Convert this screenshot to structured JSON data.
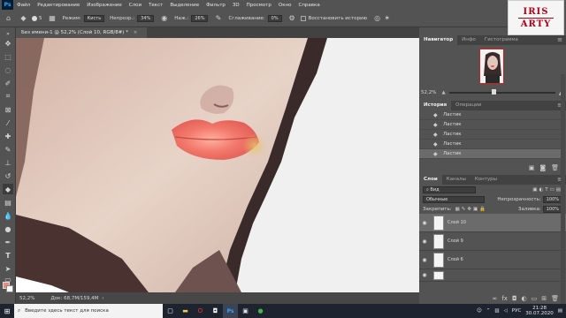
{
  "menubar": {
    "logo": "Ps",
    "items": [
      "Файл",
      "Редактирование",
      "Изображение",
      "Слои",
      "Текст",
      "Выделение",
      "Фильтр",
      "3D",
      "Просмотр",
      "Окно",
      "Справка"
    ]
  },
  "brand": {
    "line1": "IRIS",
    "line2": "ARTY"
  },
  "options": {
    "mode_label": "Режим:",
    "mode_value": "Кисть",
    "opacity_label": "Непрозр.:",
    "opacity_value": "34%",
    "pressure_label": "Наж.:",
    "pressure_value": "26%",
    "smoothing_label": "Сглаживание:",
    "smoothing_value": "0%",
    "restore_history_label": "Восстановить историю",
    "brush_size": "5"
  },
  "document": {
    "tab_label": "Без имени-1 @ 52,2% (Слой 10, RGB/8#) *"
  },
  "statusbar": {
    "zoom": "52,2%",
    "doc_info": "Док: 68,7М/159,4М"
  },
  "navigator": {
    "tabs": [
      "Навигатор",
      "Инфо",
      "Гистограмма"
    ],
    "zoom": "52,2%",
    "zoom_position": 0.42
  },
  "history": {
    "tabs": [
      "История",
      "Операции"
    ],
    "items": [
      "Ластик",
      "Ластик",
      "Ластик",
      "Ластик",
      "Ластик"
    ],
    "selected_index": 4
  },
  "layers": {
    "tabs": [
      "Слои",
      "Каналы",
      "Контуры"
    ],
    "filter_label": "Вид",
    "blend_mode": "Обычные",
    "opacity_label": "Непрозрачность:",
    "opacity_value": "100%",
    "lock_label": "Закрепить:",
    "fill_label": "Заливка:",
    "fill_value": "100%",
    "items": [
      {
        "name": "Слой 10",
        "selected": true
      },
      {
        "name": "Слой 9",
        "selected": false
      },
      {
        "name": "Слой 6",
        "selected": false
      }
    ]
  },
  "taskbar": {
    "search_placeholder": "Введите здесь текст для поиска",
    "lang": "РУС",
    "time": "21:28",
    "date": "30.07.2020"
  },
  "colors": {
    "foreground": "#e98a80",
    "background": "#ffffff",
    "ui_bg": "#535353",
    "brand_red": "#b00018"
  }
}
